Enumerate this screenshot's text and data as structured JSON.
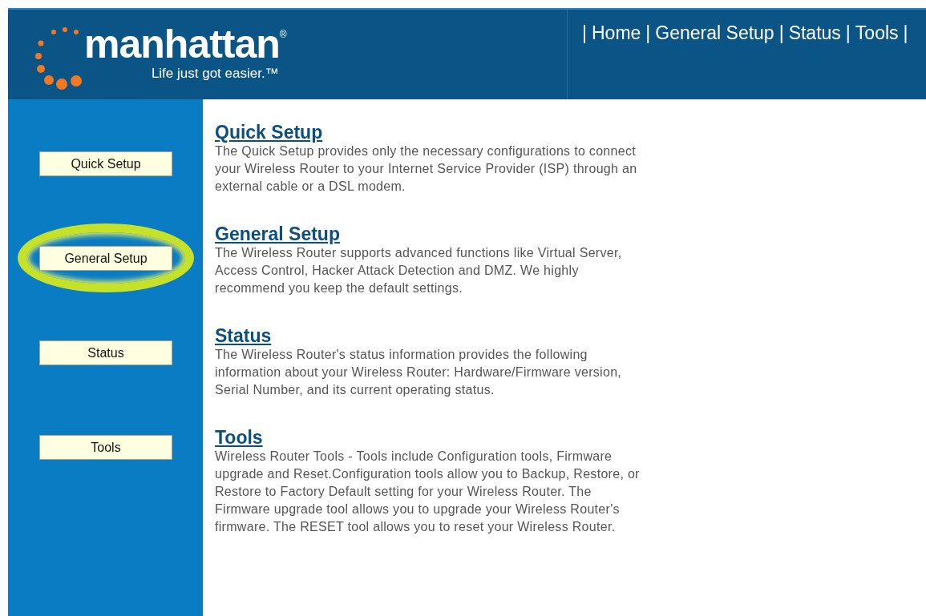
{
  "logo": {
    "name": "manhattan",
    "registered": "®",
    "tagline": "Life just got easier.™"
  },
  "nav": {
    "separator": "|",
    "items": [
      "Home",
      "General Setup",
      "Status",
      "Tools"
    ]
  },
  "sidebar": {
    "buttons": [
      {
        "label": "Quick Setup",
        "highlighted": false
      },
      {
        "label": "General Setup",
        "highlighted": true
      },
      {
        "label": "Status",
        "highlighted": false
      },
      {
        "label": "Tools",
        "highlighted": false
      }
    ]
  },
  "sections": [
    {
      "title": "Quick Setup",
      "text": "The Quick Setup provides only the necessary configurations to connect your Wireless Router to your Internet Service Provider (ISP) through an external cable or a DSL modem."
    },
    {
      "title": "General Setup",
      "text": "The Wireless Router supports advanced functions like Virtual Server, Access Control, Hacker Attack Detection and DMZ. We highly recommend you keep the default settings."
    },
    {
      "title": "Status",
      "text": "The Wireless Router's status information provides the following information about your Wireless Router: Hardware/Firmware version, Serial Number, and its current operating status."
    },
    {
      "title": "Tools",
      "text": "Wireless Router Tools - Tools include Configuration tools, Firmware upgrade and Reset.Configuration tools allow you to Backup, Restore, or Restore to Factory Default setting for your Wireless Router. The Firmware upgrade tool allows you to upgrade your Wireless Router's firmware. The RESET tool allows you to reset your Wireless Router."
    }
  ]
}
